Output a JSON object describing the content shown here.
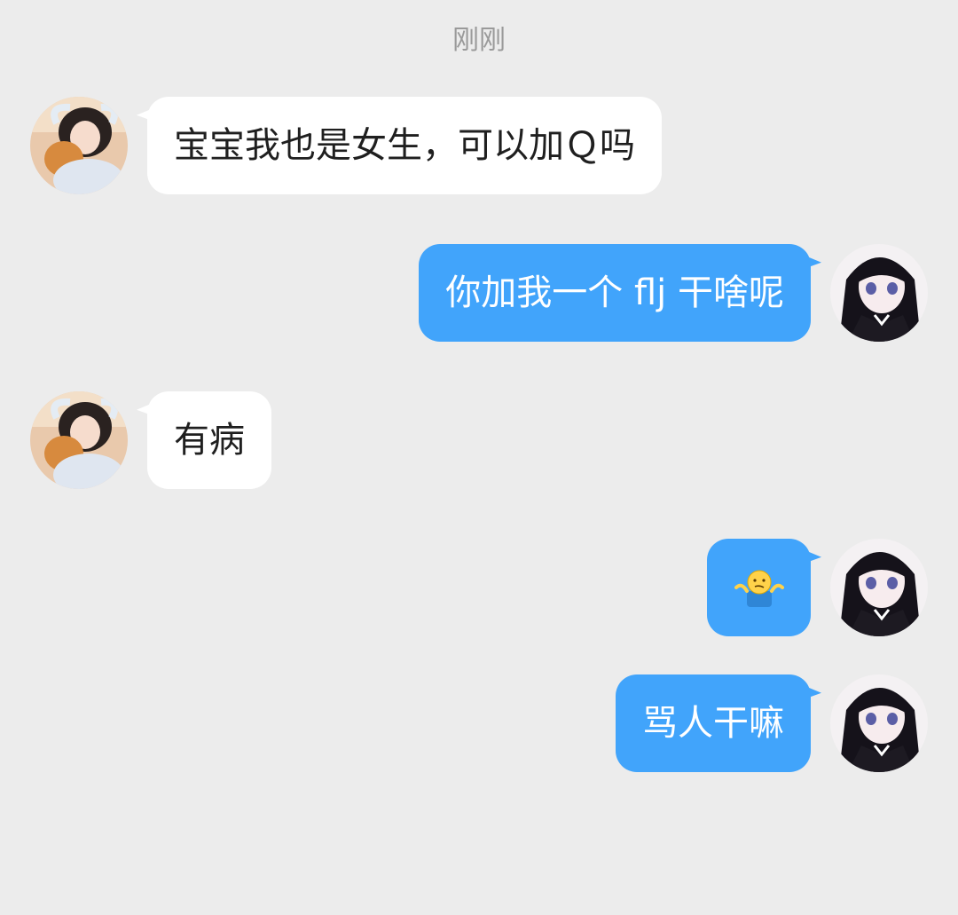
{
  "timestamp": "刚刚",
  "messages": [
    {
      "sender": "other",
      "text": "宝宝我也是女生，可以加Ｑ吗"
    },
    {
      "sender": "me",
      "text": "你加我一个 flj 干啥呢"
    },
    {
      "sender": "other",
      "text": "有病"
    },
    {
      "sender": "me",
      "emoji": "shrug-emoji"
    },
    {
      "sender": "me",
      "text": "骂人干嘛"
    }
  ],
  "colors": {
    "background": "#ececec",
    "incoming_bubble": "#ffffff",
    "outgoing_bubble": "#41a4fb",
    "timestamp": "#9a9a9a"
  }
}
